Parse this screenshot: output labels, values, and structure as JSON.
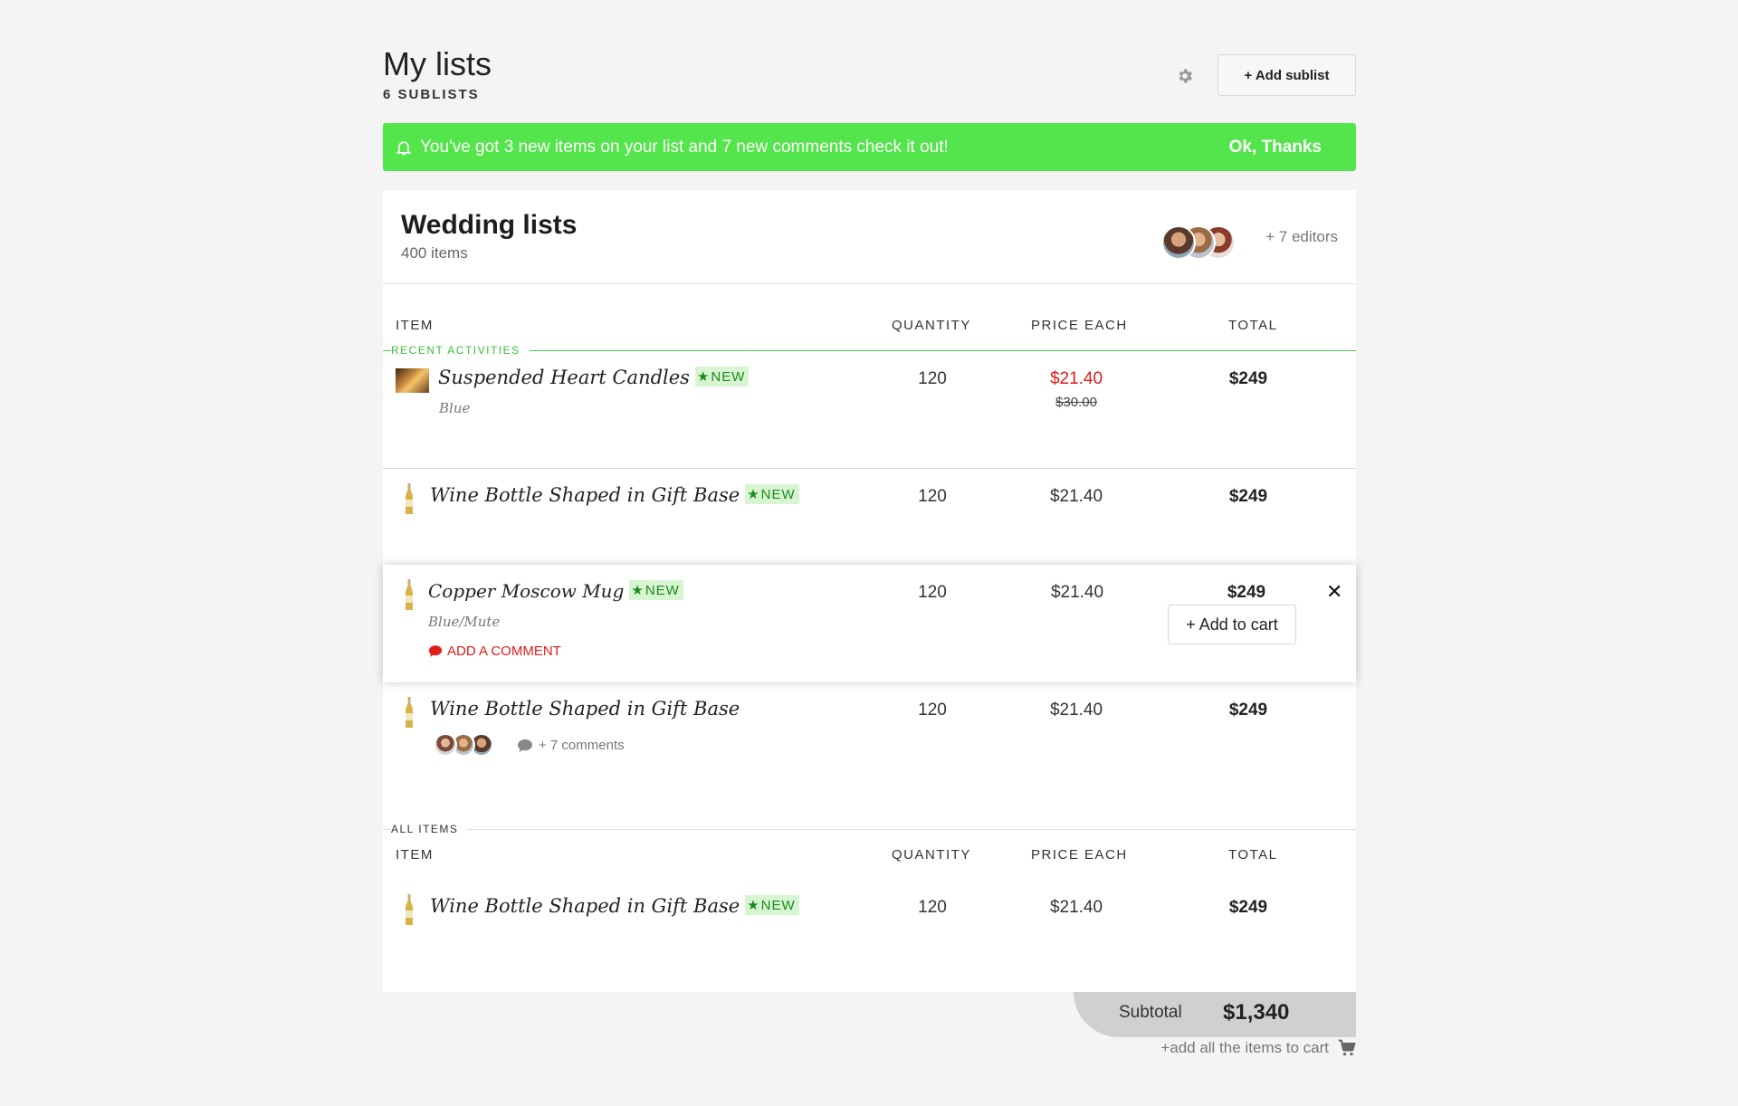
{
  "header": {
    "title": "My lists",
    "subtitle": "6 SUBLISTS",
    "add_sublist_label": "+ Add sublist"
  },
  "banner": {
    "message": "You've got 3 new items on your list and 7 new comments check it out!",
    "dismiss_label": "Ok, Thanks",
    "color": "#54e44b"
  },
  "list": {
    "title": "Wedding lists",
    "count": "400 items",
    "editors_label": "+ 7 editors"
  },
  "columns": {
    "item": "ITEM",
    "quantity": "QUANTITY",
    "price_each": "PRICE EACH",
    "total": "TOTAL"
  },
  "sections": {
    "recent": "RECENT ACTIVITIES",
    "all": "ALL ITEMS"
  },
  "badge_label": "NEW",
  "recent_items": [
    {
      "name": "Suspended Heart Candles",
      "variant": "Blue",
      "is_new": true,
      "quantity": "120",
      "price": "$21.40",
      "price_old": "$30.00",
      "total": "$249",
      "icon": "candles-thumbnail"
    },
    {
      "name": "Wine Bottle Shaped in Gift Base",
      "is_new": true,
      "quantity": "120",
      "price": "$21.40",
      "total": "$249",
      "icon": "bottle-thumbnail"
    },
    {
      "name": "Copper Moscow Mug",
      "variant": "Blue/Mute",
      "is_new": true,
      "quantity": "120",
      "price": "$21.40",
      "total": "$249",
      "add_comment_label": "ADD A COMMENT",
      "add_to_cart_label": "+ Add to cart",
      "icon": "bottle-thumbnail"
    },
    {
      "name": "Wine Bottle Shaped in Gift Base",
      "is_new": false,
      "quantity": "120",
      "price": "$21.40",
      "total": "$249",
      "comments_label": "+ 7 comments",
      "icon": "bottle-thumbnail"
    }
  ],
  "all_items": [
    {
      "name": "Wine Bottle Shaped in Gift Base",
      "is_new": true,
      "quantity": "120",
      "price": "$21.40",
      "total": "$249",
      "icon": "bottle-thumbnail"
    }
  ],
  "footer": {
    "subtotal_label": "Subtotal",
    "subtotal_value": "$1,340",
    "add_all_label": "+add all the items to cart"
  },
  "colors": {
    "accent_green": "#54e44b",
    "sale_red": "#e31b1b",
    "badge_bg": "#d8f5d2"
  }
}
